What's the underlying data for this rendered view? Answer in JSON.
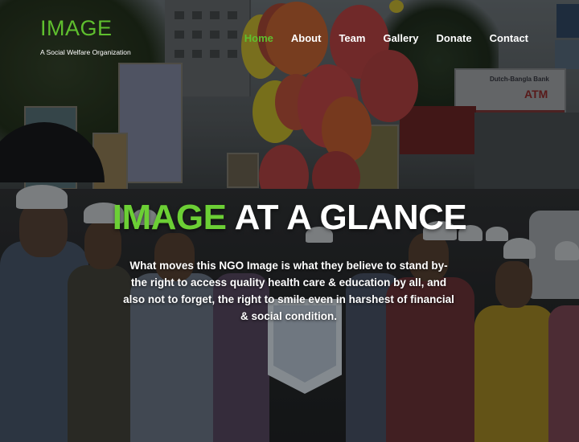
{
  "brand": {
    "name": "IMAGE",
    "tagline": "A Social Welfare Organization"
  },
  "nav": {
    "items": [
      {
        "label": "Home",
        "active": true
      },
      {
        "label": "About",
        "active": false
      },
      {
        "label": "Team",
        "active": false
      },
      {
        "label": "Gallery",
        "active": false
      },
      {
        "label": "Donate",
        "active": false
      },
      {
        "label": "Contact",
        "active": false
      }
    ]
  },
  "hero": {
    "title_accent": "IMAGE",
    "title_rest": " AT A GLANCE",
    "description": "What moves this NGO Image is what they believe to stand by- the right to access quality health care & education by all, and also not to forget, the right to smile even in harshest of financial & social condition.",
    "background_signs": {
      "bank_name": "Dutch-Bangla Bank",
      "atm": "ATM"
    }
  },
  "colors": {
    "accent": "#6ccf35",
    "nav_active": "#5fbf2e",
    "text": "#ffffff"
  }
}
